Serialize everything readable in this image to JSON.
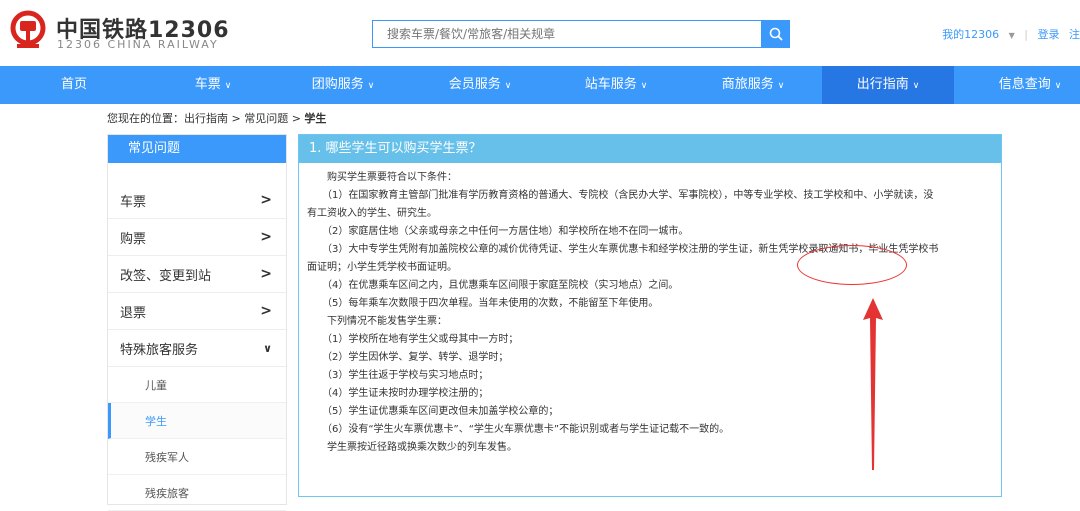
{
  "header": {
    "brand_cn": "中国铁路12306",
    "brand_en": "12306 CHINA RAILWAY",
    "search_placeholder": "搜索车票/餐饮/常旅客/相关规章",
    "my_account": "我的12306",
    "login": "登录",
    "register": "注"
  },
  "nav": [
    {
      "label": "首页",
      "caret": false
    },
    {
      "label": "车票",
      "caret": true
    },
    {
      "label": "团购服务",
      "caret": true
    },
    {
      "label": "会员服务",
      "caret": true
    },
    {
      "label": "站车服务",
      "caret": true
    },
    {
      "label": "商旅服务",
      "caret": true
    },
    {
      "label": "出行指南",
      "caret": true,
      "active": true
    },
    {
      "label": "信息查询",
      "caret": true
    }
  ],
  "breadcrumb": {
    "prefix": "您现在的位置：出行指南 > 常见问题 > ",
    "current": "学生"
  },
  "sidebar": {
    "title": "常见问题",
    "items": [
      {
        "label": "车票",
        "icon": "chevron-right-icon"
      },
      {
        "label": "购票",
        "icon": "chevron-right-icon"
      },
      {
        "label": "改签、变更到站",
        "icon": "chevron-right-icon"
      },
      {
        "label": "退票",
        "icon": "chevron-right-icon"
      },
      {
        "label": "特殊旅客服务",
        "icon": "chevron-down-icon"
      }
    ],
    "subitems": [
      {
        "label": "儿童",
        "active": false
      },
      {
        "label": "学生",
        "active": true
      },
      {
        "label": "残疾军人",
        "active": false
      },
      {
        "label": "残疾旅客",
        "active": false
      }
    ]
  },
  "content": {
    "title": "1. 哪些学生可以购买学生票？",
    "lines": [
      "　　购买学生票要符合以下条件：",
      "　　（1）在国家教育主管部门批准有学历教育资格的普通大、专院校（含民办大学、军事院校），中等专业学校、技工学校和中、小学就读，没",
      "有工资收入的学生、研究生。",
      "　　（2）家庭居住地（父亲或母亲之中任何一方居住地）和学校所在地不在同一城市。",
      "　　（3）大中专学生凭附有加盖院校公章的减价优待凭证、学生火车票优惠卡和经学校注册的学生证，新生凭学校录取通知书，毕业生凭学校书",
      "面证明；小学生凭学校书面证明。",
      "　　（4）在优惠乘车区间之内，且优惠乘车区间限于家庭至院校（实习地点）之间。",
      "　　（5）每年乘车次数限于四次单程。当年未使用的次数，不能留至下年使用。",
      "　　下列情况不能发售学生票：",
      "　　（1）学校所在地有学生父或母其中一方时；",
      "　　（2）学生因休学、复学、转学、退学时；",
      "　　（3）学生往返于学校与实习地点时；",
      "　　（4）学生证未按时办理学校注册的；",
      "　　（5）学生证优惠乘车区间更改但未加盖学校公章的；",
      "　　（6）没有“学生火车票优惠卡”、“学生火车票优惠卡”不能识别或者与学生证记载不一致的。",
      "　　学生票按近径路或换乘次数少的列车发售。"
    ]
  },
  "colors": {
    "primary": "#3b99fc",
    "nav_active": "#2676e3",
    "content_header": "#66c0ea",
    "logo_red": "#d8261f",
    "annotation_red": "#e33333"
  }
}
